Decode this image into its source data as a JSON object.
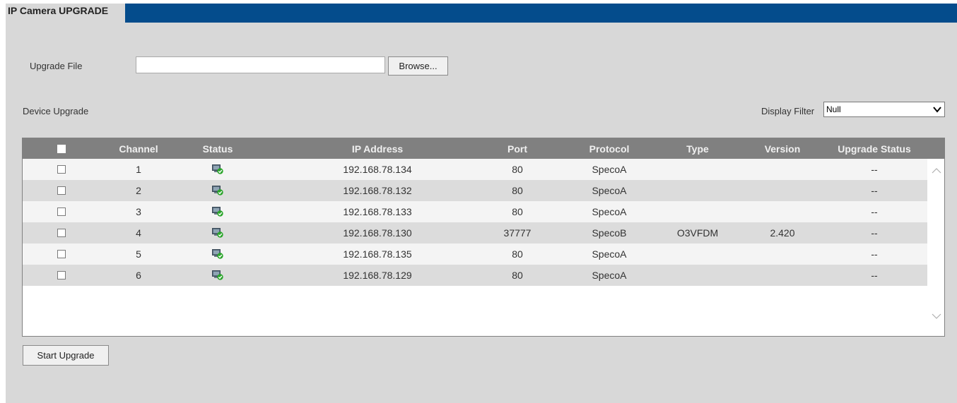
{
  "title": "IP Camera UPGRADE",
  "upgrade_file": {
    "label": "Upgrade File",
    "value": "",
    "browse_label": "Browse..."
  },
  "device_upgrade_label": "Device Upgrade",
  "display_filter": {
    "label": "Display Filter",
    "selected": "Null"
  },
  "table": {
    "columns": [
      "Channel",
      "Status",
      "IP Address",
      "Port",
      "Protocol",
      "Type",
      "Version",
      "Upgrade Status"
    ],
    "rows": [
      {
        "channel": "1",
        "status_icon": "online-device-icon",
        "ip": "192.168.78.134",
        "port": "80",
        "protocol": "SpecoA",
        "type": "",
        "version": "",
        "upgrade_status": "--"
      },
      {
        "channel": "2",
        "status_icon": "online-device-icon",
        "ip": "192.168.78.132",
        "port": "80",
        "protocol": "SpecoA",
        "type": "",
        "version": "",
        "upgrade_status": "--"
      },
      {
        "channel": "3",
        "status_icon": "online-device-icon",
        "ip": "192.168.78.133",
        "port": "80",
        "protocol": "SpecoA",
        "type": "",
        "version": "",
        "upgrade_status": "--"
      },
      {
        "channel": "4",
        "status_icon": "online-device-icon",
        "ip": "192.168.78.130",
        "port": "37777",
        "protocol": "SpecoB",
        "type": "O3VFDM",
        "version": "2.420",
        "upgrade_status": "--"
      },
      {
        "channel": "5",
        "status_icon": "online-device-icon",
        "ip": "192.168.78.135",
        "port": "80",
        "protocol": "SpecoA",
        "type": "",
        "version": "",
        "upgrade_status": "--"
      },
      {
        "channel": "6",
        "status_icon": "online-device-icon",
        "ip": "192.168.78.129",
        "port": "80",
        "protocol": "SpecoA",
        "type": "",
        "version": "",
        "upgrade_status": "--"
      }
    ]
  },
  "start_upgrade_label": "Start Upgrade",
  "colors": {
    "title_bar": "#044c8c",
    "panel": "#d8d8d8",
    "header": "#808080",
    "status_ok": "#2aa52a"
  }
}
